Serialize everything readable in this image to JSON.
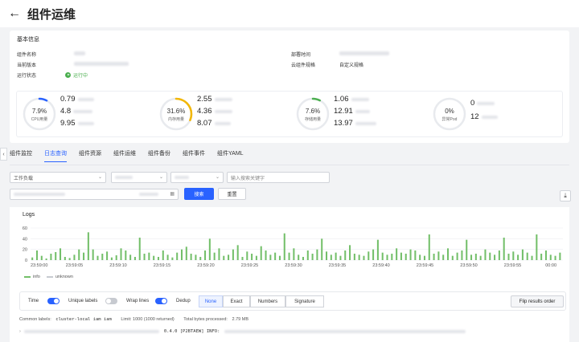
{
  "header": {
    "back_icon": "arrow-left-icon",
    "title": "组件运维"
  },
  "basic": {
    "section_title": "基本信息",
    "labels": {
      "name": "组件名称",
      "version": "当前版本",
      "status": "运行状态",
      "deploy_time": "部署时间",
      "spec": "云组件规格"
    },
    "status_text": "运行中",
    "spec_value": "自定义规格"
  },
  "metrics": {
    "cpu": {
      "percent": "7.9%",
      "label": "CPU用量",
      "fraction": 0.079,
      "values": [
        "0.79",
        "4.8",
        "9.95"
      ],
      "color": "#2962ff"
    },
    "mem": {
      "percent": "31.6%",
      "label": "内存用量",
      "fraction": 0.316,
      "values": [
        "2.55",
        "4.36",
        "8.07"
      ],
      "color": "#f2b705"
    },
    "storage": {
      "percent": "7.6%",
      "label": "存储用量",
      "fraction": 0.076,
      "values": [
        "1.06",
        "12.91",
        "13.97"
      ],
      "color": "#4caf50"
    },
    "pod": {
      "percent": "0%",
      "label": "异常Pod",
      "fraction": 0,
      "values": [
        "0",
        "12"
      ],
      "color": "#2962ff"
    }
  },
  "tabs": [
    "组件监控",
    "日志查询",
    "组件资源",
    "组件运维",
    "组件备份",
    "组件事件",
    "组件YAML"
  ],
  "filters": {
    "workload": "工作负载",
    "keyword_placeholder": "输入搜索关键字",
    "search_label": "搜索",
    "reset_label": "重置",
    "calendar_icon": "calendar-icon",
    "download_icon": "download-icon"
  },
  "logs": {
    "title": "Logs",
    "legend": [
      "info",
      "unknown"
    ],
    "controls": {
      "time": "Time",
      "unique_labels": "Unique labels",
      "wrap_lines": "Wrap lines",
      "dedup": "Dedup",
      "dedup_options": [
        "None",
        "Exact",
        "Numbers",
        "Signature"
      ],
      "flip": "Flip results order"
    },
    "common_labels_label": "Common labels:",
    "common_labels_value": "cluster-local iam iam",
    "limit": "Limit: 1000 (1000 returned)",
    "bytes_label": "Total bytes processed:",
    "bytes_value": "2.79 MB",
    "line_text": "0.4.0 [P2BTAEW] INFO:"
  },
  "chart_data": {
    "type": "bar",
    "title": "",
    "xlabel": "",
    "ylabel": "",
    "ylim": [
      0,
      60
    ],
    "yticks": [
      "60",
      "40",
      "20",
      "0"
    ],
    "xticks": [
      "23:59:00",
      "23:59:05",
      "23:59:10",
      "23:59:15",
      "23:59:20",
      "23:59:25",
      "23:59:30",
      "23:59:35",
      "23:59:40",
      "23:59:45",
      "23:59:50",
      "23:59:55",
      "00:00"
    ],
    "series": [
      {
        "name": "info",
        "color": "#73bf69",
        "values": [
          5,
          18,
          8,
          3,
          12,
          15,
          22,
          6,
          4,
          10,
          20,
          14,
          52,
          20,
          8,
          12,
          16,
          5,
          9,
          22,
          18,
          10,
          6,
          42,
          12,
          14,
          8,
          6,
          18,
          10,
          5,
          14,
          20,
          25,
          12,
          10,
          6,
          18,
          40,
          14,
          22,
          8,
          10,
          20,
          28,
          6,
          16,
          12,
          8,
          26,
          18,
          10,
          14,
          8,
          50,
          14,
          22,
          10,
          6,
          18,
          12,
          20,
          40,
          16,
          10,
          14,
          8,
          18,
          28,
          12,
          10,
          8,
          16,
          20,
          38,
          14,
          10,
          12,
          22,
          14,
          12,
          20,
          18,
          10,
          8,
          48,
          12,
          16,
          10,
          22,
          8,
          14,
          18,
          38,
          10,
          12,
          8,
          20,
          14,
          10,
          18,
          42,
          12,
          16,
          10,
          20,
          14,
          8,
          48,
          12,
          18,
          10,
          8,
          14
        ]
      }
    ]
  }
}
